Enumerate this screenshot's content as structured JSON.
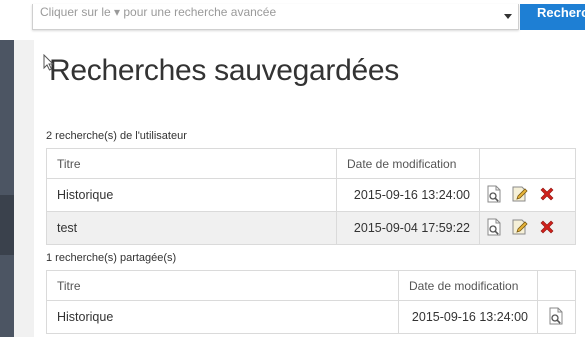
{
  "search": {
    "placeholder": "Cliquer sur le ▾ pour une recherche avancée",
    "button_label": "Recherche"
  },
  "page": {
    "title": "Recherches sauvegardées"
  },
  "user_searches": {
    "count_label": "2 recherche(s) de l'utilisateur",
    "columns": [
      "Titre",
      "Date de modification",
      ""
    ],
    "rows": [
      {
        "title": "Historique",
        "date": "2015-09-16 13:24:00",
        "actions": [
          "view-icon",
          "edit-icon",
          "delete-icon"
        ]
      },
      {
        "title": "test",
        "date": "2015-09-04 17:59:22",
        "actions": [
          "view-icon",
          "edit-icon",
          "delete-icon"
        ]
      }
    ]
  },
  "shared_searches": {
    "count_label": "1 recherche(s) partagée(s)",
    "columns": [
      "Titre",
      "Date de modification",
      ""
    ],
    "rows": [
      {
        "title": "Historique",
        "date": "2015-09-16 13:24:00",
        "actions": [
          "view-icon"
        ]
      }
    ]
  },
  "colors": {
    "accent": "#1e7fd4",
    "delete": "#d0211c",
    "sidebar": "#4c5563"
  }
}
